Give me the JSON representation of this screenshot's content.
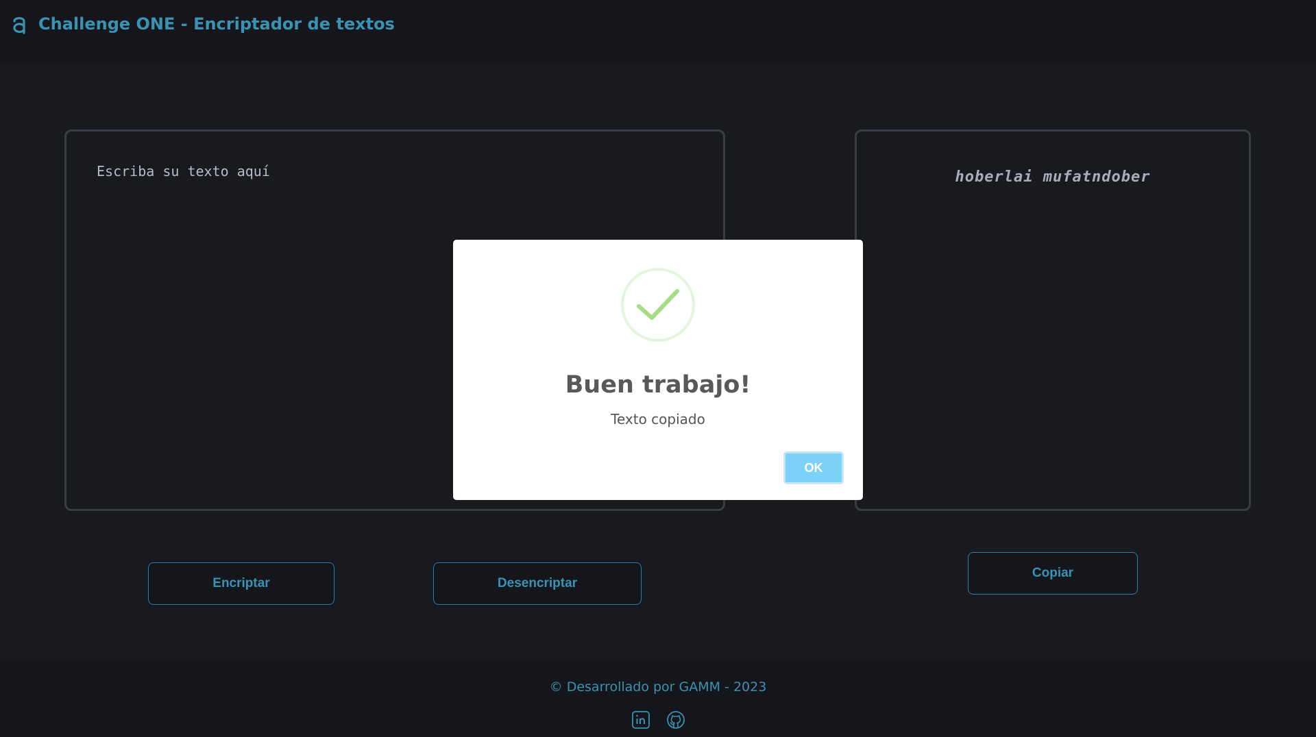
{
  "header": {
    "title": "Challenge ONE - Encriptador de textos",
    "logo_icon": "alura-logo-icon"
  },
  "input_panel": {
    "placeholder": "Escriba su texto aquí"
  },
  "output_panel": {
    "text": "hoberlai mufatndober"
  },
  "buttons": {
    "encrypt_label": "Encriptar",
    "decrypt_label": "Desencriptar",
    "copy_label": "Copiar"
  },
  "modal": {
    "icon": "success-check-icon",
    "title": "Buen trabajo!",
    "text": "Texto copiado",
    "ok_label": "OK"
  },
  "footer": {
    "copyright": "© Desarrollado por GAMM - 2023",
    "social_icons": [
      "linkedin-icon",
      "github-icon"
    ]
  },
  "colors": {
    "accent": "#3b93b3",
    "background": "#181a20",
    "modal_button": "#7cd1f9",
    "success": "#a5dc86"
  }
}
